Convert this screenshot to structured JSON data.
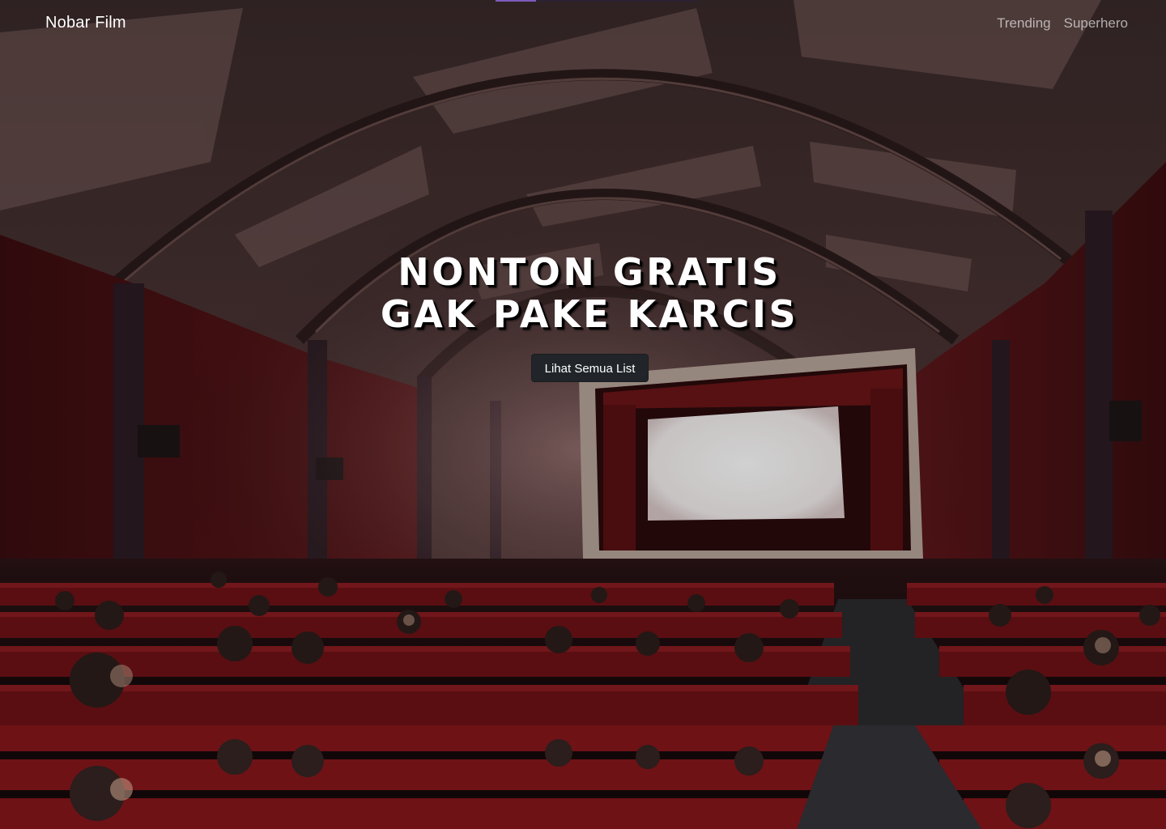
{
  "navbar": {
    "brand": "Nobar Film",
    "links": [
      {
        "label": "Trending"
      },
      {
        "label": "Superhero"
      }
    ]
  },
  "hero": {
    "headline_line1": "NONTON GRATIS",
    "headline_line2": "GAK PAKE KARCIS",
    "cta_label": "Lihat Semua List"
  },
  "colors": {
    "cta_background": "#212529",
    "brand_text": "#ffffff",
    "nav_link_text": "#c9c9c9",
    "wall_red": "#6b1a1c",
    "seat_red": "#7a1417",
    "screen_glow": "#ffffff"
  }
}
